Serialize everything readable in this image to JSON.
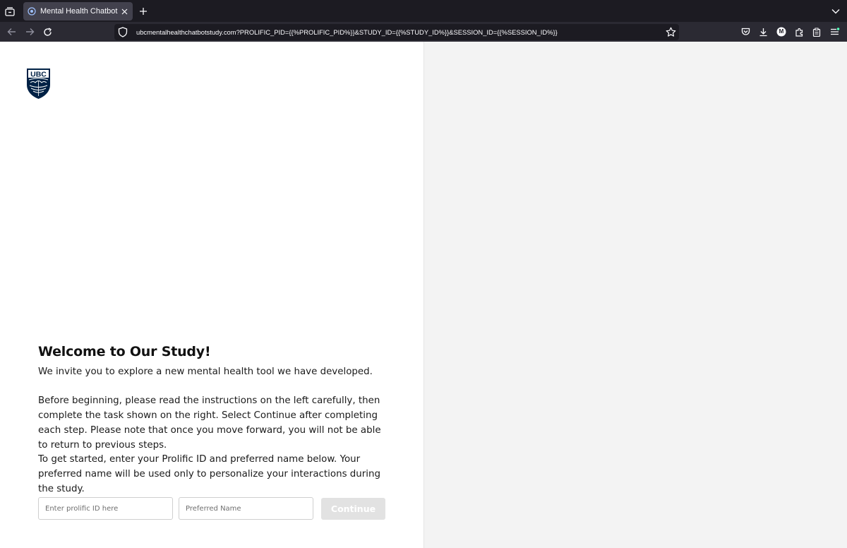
{
  "browser": {
    "tab": {
      "title": "Mental Health Chatbot Study"
    },
    "url": "ubcmentalhealthchatbotstudy.com?PROLIFIC_PID={{%PROLIFIC_PID%}}&STUDY_ID={{%STUDY_ID%}}&SESSION_ID={{%SESSION_ID%}}",
    "account_initial": "M",
    "colors": {
      "chrome_bg": "#1c1b22",
      "toolbar_bg": "#2b2a33",
      "tab_active": "#42414d",
      "extension_badge": "#54ffbd"
    }
  },
  "logo": {
    "text": "UBC",
    "color": "#002145"
  },
  "welcome": {
    "heading": "Welcome to Our Study!",
    "intro": "We invite you to explore a new mental health tool we have developed.",
    "instructions": "Before beginning, please read the instructions on the left carefully, then complete the task shown on the right. Select Continue after completing each step. Please note that once you move forward, you will not be able to return to previous steps.",
    "get_started": "To get started, enter your Prolific ID and preferred name below. Your preferred name will be used only to personalize your interactions during the study."
  },
  "form": {
    "prolific_id": {
      "placeholder": "Enter prolific ID here",
      "value": ""
    },
    "preferred_name": {
      "placeholder": "Preferred Name",
      "value": ""
    },
    "continue_label": "Continue",
    "continue_disabled": true
  }
}
